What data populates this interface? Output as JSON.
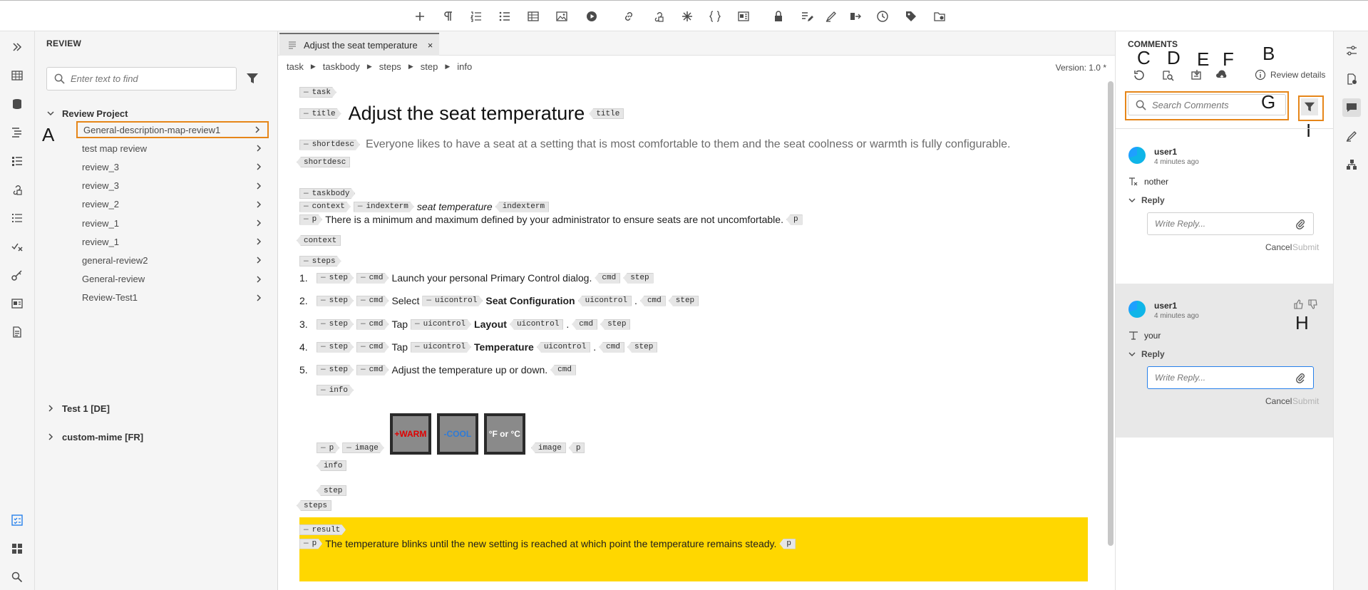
{
  "review": {
    "panel_title": "REVIEW",
    "search_placeholder": "Enter text to find",
    "project": "Review Project",
    "items": [
      "General-description-map-review1",
      "test map review",
      "review_3",
      "review_3",
      "review_2",
      "review_1",
      "review_1",
      "general-review2",
      "General-review",
      "Review-Test1"
    ],
    "other_projects": [
      "Test 1 [DE]",
      "custom-mime [FR]"
    ]
  },
  "annotations": {
    "a": "A",
    "b": "B",
    "c": "C",
    "d": "D",
    "e": "E",
    "f": "F",
    "g": "G",
    "h": "H",
    "i": "I"
  },
  "editor": {
    "tab_title": "Adjust the seat temperature",
    "tab_close": "×",
    "breadcrumb": [
      "task",
      "taskbody",
      "steps",
      "step",
      "info"
    ],
    "version": "Version: 1.0 *",
    "tags": {
      "task": "task",
      "title": "title",
      "shortdesc": "shortdesc",
      "taskbody": "taskbody",
      "context": "context",
      "indexterm": "indexterm",
      "p": "p",
      "steps": "steps",
      "step": "step",
      "cmd": "cmd",
      "uicontrol": "uicontrol",
      "info": "info",
      "image": "image",
      "result": "result"
    },
    "title_text": "Adjust the seat temperature",
    "shortdesc_text": "Everyone likes to have a seat at a setting that is most comfortable to them and the seat coolness or warmth is fully configurable.",
    "indexterm_text": "seat temperature",
    "context_p": "There is a minimum and maximum defined by your administrator to ensure seats are not uncomfortable.",
    "steps": [
      {
        "num": "1.",
        "pre": "Launch your personal Primary Control dialog.",
        "ui": "",
        "post": ""
      },
      {
        "num": "2.",
        "pre": "Select",
        "ui": "Seat Configuration",
        "post": "."
      },
      {
        "num": "3.",
        "pre": "Tap",
        "ui": "Layout",
        "post": "."
      },
      {
        "num": "4.",
        "pre": "Tap",
        "ui": "Temperature",
        "post": "."
      },
      {
        "num": "5.",
        "pre": "Adjust the temperature up or down.",
        "ui": "",
        "post": ""
      }
    ],
    "buttons": [
      {
        "label": "+WARM",
        "color": "#e00000"
      },
      {
        "label": "-COOL",
        "color": "#2f7bd8"
      },
      {
        "label": "°F or °C",
        "color": "#ffffff"
      }
    ],
    "result_p": "The temperature blinks until the new setting is reached at which point the temperature remains steady."
  },
  "comments": {
    "panel_title": "COMMENTS",
    "review_details": "Review details",
    "search_placeholder": "Search Comments",
    "items": [
      {
        "user": "user1",
        "time": "4 minutes ago",
        "text": "nother",
        "reply_label": "Reply",
        "reply_placeholder": "Write Reply...",
        "cancel": "Cancel",
        "submit": "Submit"
      },
      {
        "user": "user1",
        "time": "4 minutes ago",
        "text": "your",
        "reply_label": "Reply",
        "reply_placeholder": "Write Reply...",
        "cancel": "Cancel",
        "submit": "Submit"
      }
    ]
  },
  "colors": {
    "highlight_outline": "#e68619",
    "result_background": "#ffd700",
    "focus_border": "#2680eb"
  }
}
